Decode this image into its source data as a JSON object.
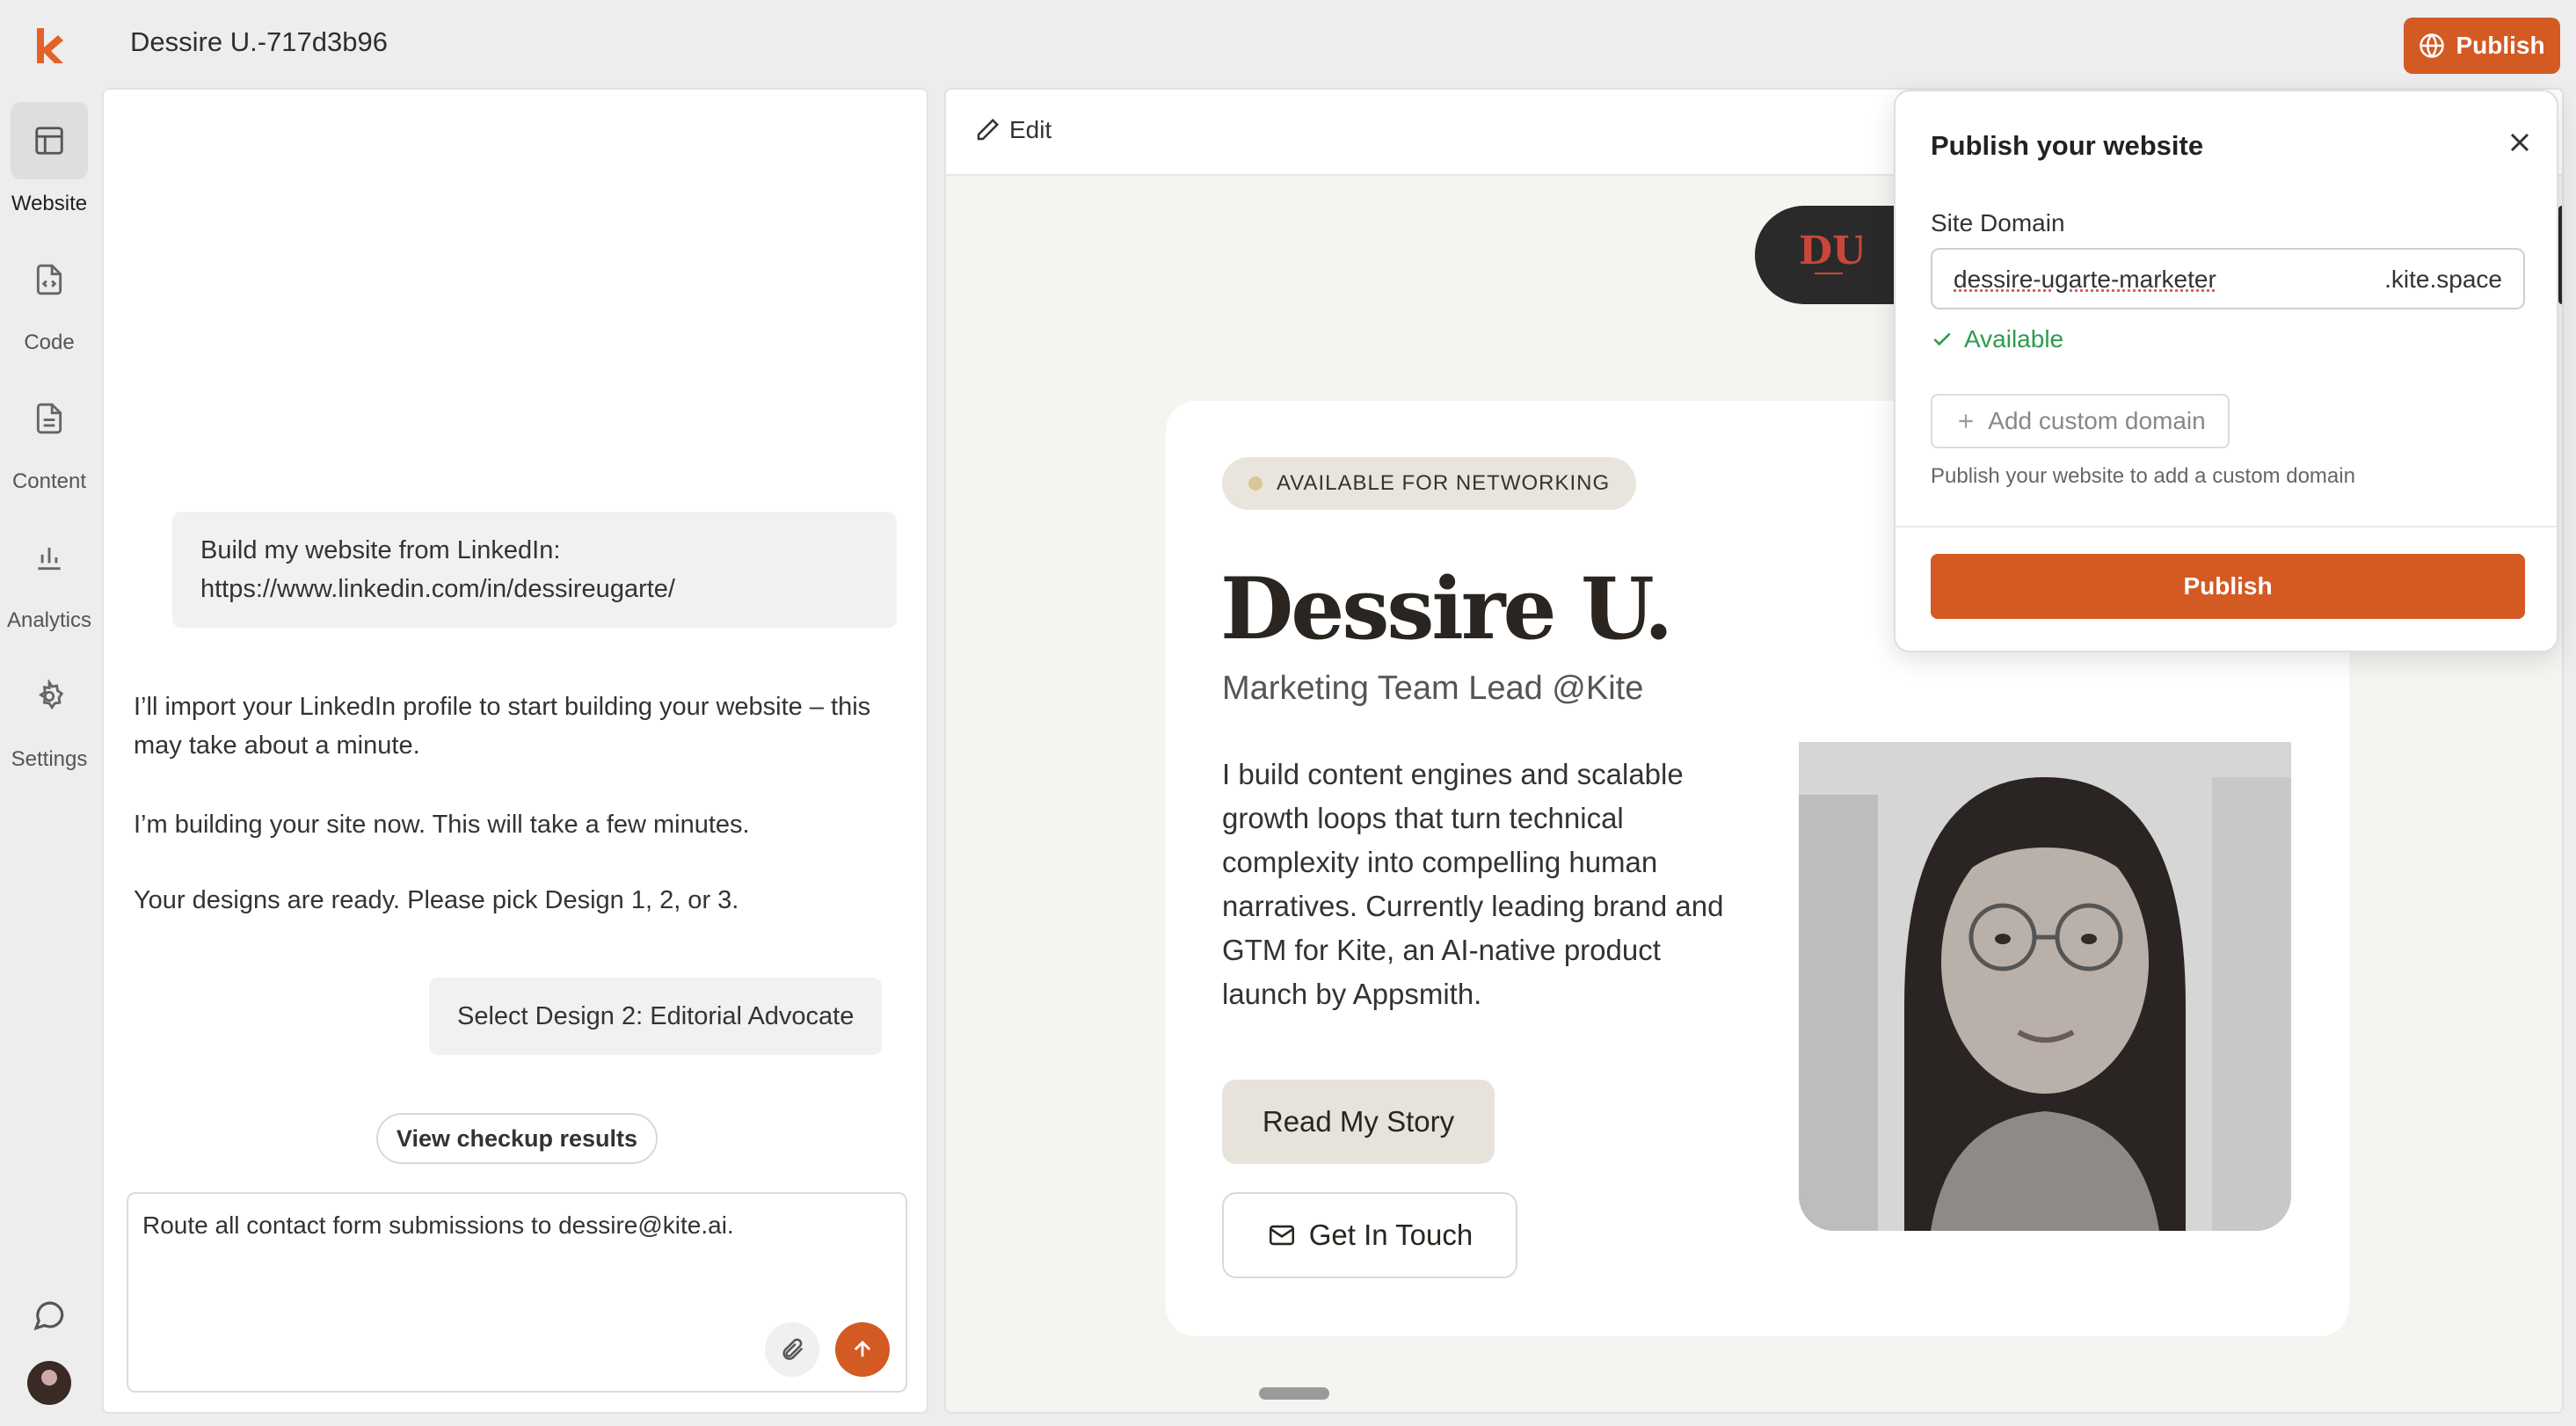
{
  "app": {
    "title": "Dessire U.-717d3b96",
    "publish_label": "Publish"
  },
  "rail": {
    "items": [
      {
        "label": "Website",
        "icon": "layout-icon",
        "active": true
      },
      {
        "label": "Code",
        "icon": "code-file-icon"
      },
      {
        "label": "Content",
        "icon": "document-icon"
      },
      {
        "label": "Analytics",
        "icon": "bar-chart-icon"
      },
      {
        "label": "Settings",
        "icon": "gear-icon"
      }
    ]
  },
  "chat": {
    "messages": [
      {
        "role": "user",
        "text": "Build my website from LinkedIn: https://www.linkedin.com/in/dessireugarte/"
      },
      {
        "role": "assistant",
        "text": "I’ll import your LinkedIn profile to start building your website – this may take about a minute."
      },
      {
        "role": "assistant",
        "text": "I’m building your site now. This will take a few minutes."
      },
      {
        "role": "assistant",
        "text": "Your designs are ready. Please pick Design 1, 2, or 3."
      },
      {
        "role": "user",
        "text": "Select Design 2: Editorial Advocate"
      }
    ],
    "checkup_label": "View checkup results",
    "composer_value": "Route all contact form submissions to dessire@kite.ai."
  },
  "preview": {
    "edit_label": "Edit",
    "monogram": "DU",
    "badge": "AVAILABLE FOR NETWORKING",
    "name": "Dessire U.",
    "role": "Marketing Team Lead @Kite",
    "bio": "I build content engines and scalable growth loops that turn technical complexity into compelling human narratives. Currently leading brand and GTM for Kite, an AI-native product launch by Appsmith.",
    "read_story_label": "Read My Story",
    "get_in_touch_label": "Get In Touch"
  },
  "publish_dialog": {
    "title": "Publish your website",
    "site_domain_label": "Site Domain",
    "domain_value": "dessire-ugarte-marketer",
    "domain_suffix": ".kite.space",
    "availability": "Available",
    "add_custom_domain_label": "Add custom domain",
    "hint": "Publish your website to add a custom domain",
    "publish_label": "Publish"
  },
  "colors": {
    "accent": "#d35a23",
    "available": "#2e9b4d"
  }
}
